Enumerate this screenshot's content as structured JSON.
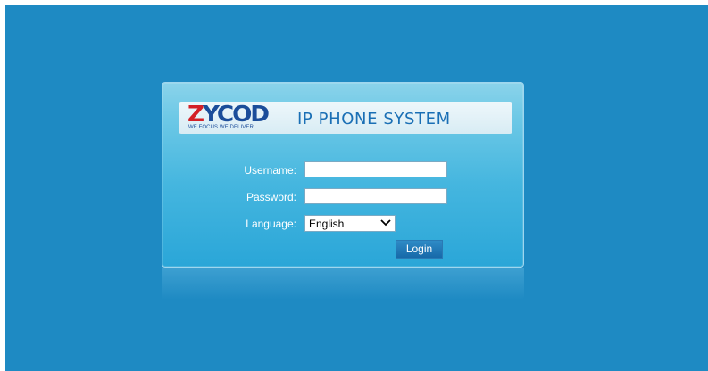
{
  "header": {
    "logo_text_red": "Z",
    "logo_text_blue": "YCOD",
    "logo_tagline": "WE FOCUS.WE DELIVER",
    "system_title": "IP PHONE SYSTEM"
  },
  "form": {
    "username_label": "Username:",
    "username_value": "",
    "password_label": "Password:",
    "password_value": "",
    "language_label": "Language:",
    "language_selected": "English",
    "login_label": "Login"
  },
  "icons": {
    "dropdown": "chevron-down-icon"
  },
  "colors": {
    "background": "#1e8ac3",
    "logo_red": "#d32027",
    "logo_blue": "#1b4d9a",
    "title_blue": "#1a6fb5",
    "button": "#1769a9"
  }
}
